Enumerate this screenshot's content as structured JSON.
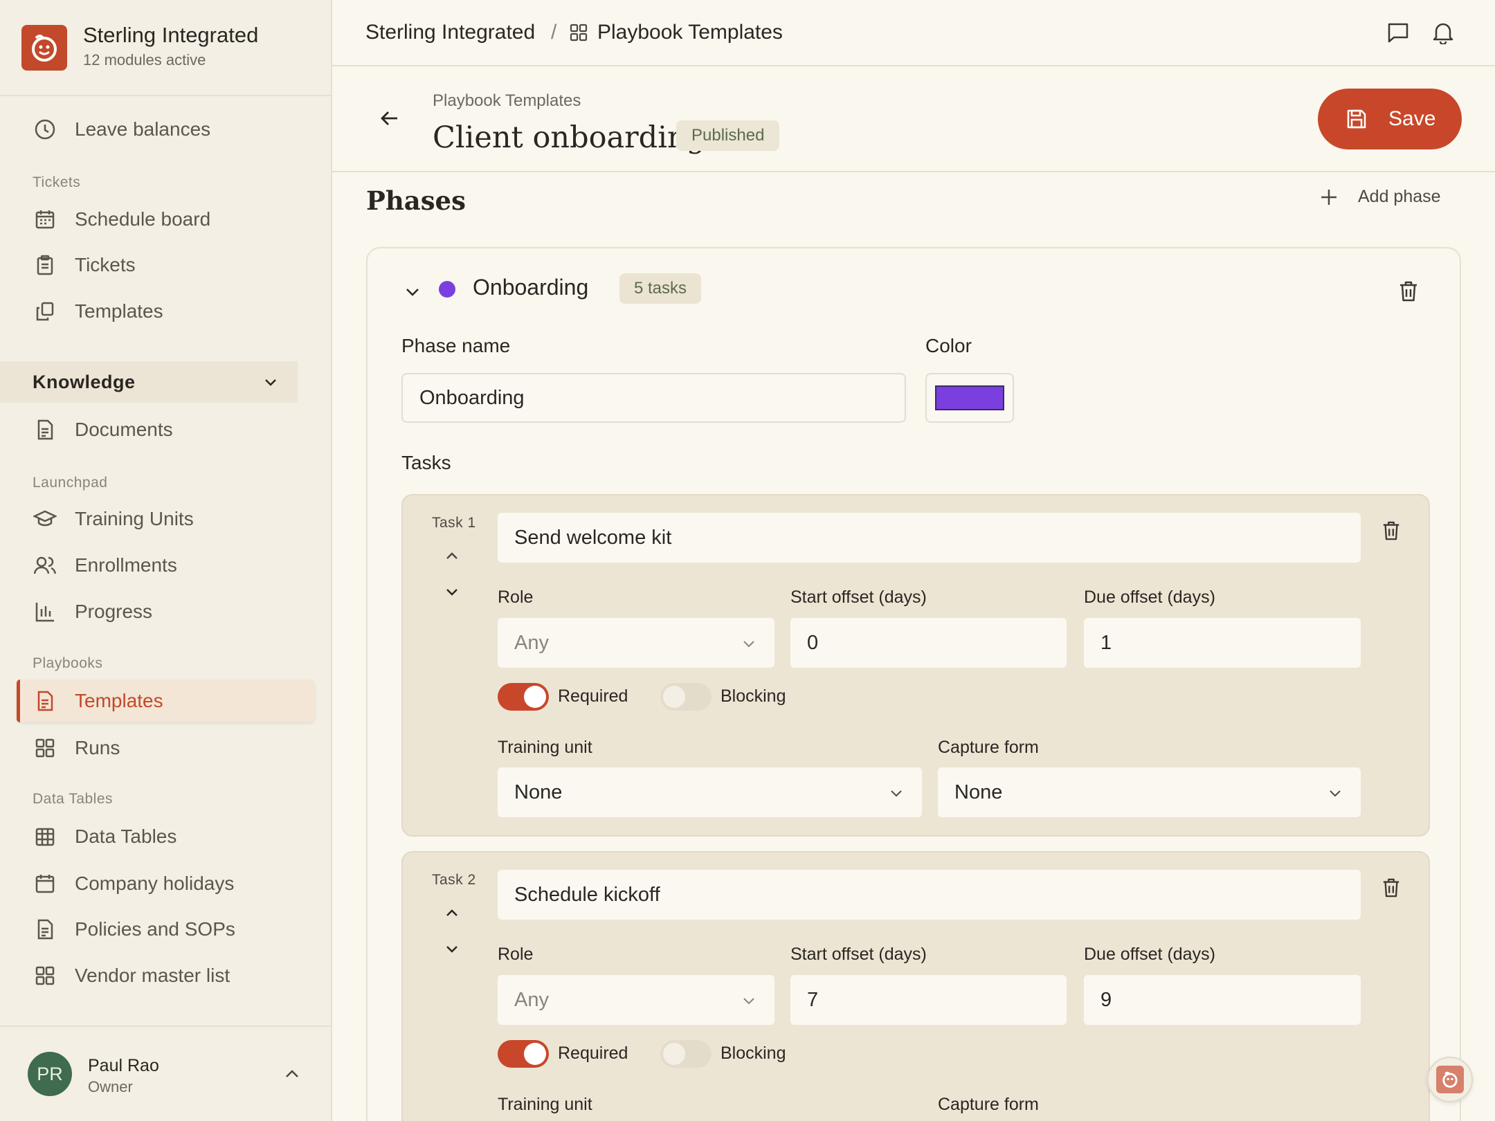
{
  "org": {
    "name": "Sterling Integrated",
    "subtitle": "12 modules active"
  },
  "sidebar": {
    "top_items": [
      {
        "label": "Leave balances",
        "icon": "clock-icon"
      }
    ],
    "sections": {
      "tickets": "Tickets",
      "launchpad": "Launchpad",
      "playbooks": "Playbooks",
      "data_tables": "Data Tables"
    },
    "tickets_items": [
      {
        "label": "Schedule board",
        "icon": "calendar-icon"
      },
      {
        "label": "Tickets",
        "icon": "clipboard-icon"
      },
      {
        "label": "Templates",
        "icon": "copy-icon"
      }
    ],
    "knowledge": {
      "label": "Knowledge",
      "items": [
        {
          "label": "Documents",
          "icon": "document-icon"
        }
      ]
    },
    "launchpad_items": [
      {
        "label": "Training Units",
        "icon": "graduation-cap-icon"
      },
      {
        "label": "Enrollments",
        "icon": "users-icon"
      },
      {
        "label": "Progress",
        "icon": "bar-chart-icon"
      }
    ],
    "playbooks_items": [
      {
        "label": "Templates",
        "icon": "document-icon",
        "active": true
      },
      {
        "label": "Runs",
        "icon": "grid-icon"
      }
    ],
    "data_tables_items": [
      {
        "label": "Data Tables",
        "icon": "table-icon"
      },
      {
        "label": "Company holidays",
        "icon": "calendar-icon"
      },
      {
        "label": "Policies and SOPs",
        "icon": "document-icon"
      },
      {
        "label": "Vendor master list",
        "icon": "grid-icon"
      }
    ],
    "user": {
      "initials": "PR",
      "name": "Paul Rao",
      "role": "Owner"
    }
  },
  "topbar": {
    "breadcrumb_root": "Sterling Integrated",
    "separator": "/",
    "breadcrumb_current": "Playbook Templates"
  },
  "header": {
    "breadcrumb": "Playbook Templates",
    "title": "Client onboarding",
    "status": "Published",
    "save_label": "Save"
  },
  "phases": {
    "title": "Phases",
    "add_label": "Add phase",
    "phase": {
      "name": "Onboarding",
      "task_count": "5 tasks",
      "color": "#7b3fe0",
      "phase_name_label": "Phase name",
      "phase_name_value": "Onboarding",
      "color_label": "Color",
      "tasks_label": "Tasks",
      "tasks": [
        {
          "num_label": "Task 1",
          "title": "Send welcome kit",
          "role_label": "Role",
          "role_value": "Any",
          "start_label": "Start offset (days)",
          "start_value": "0",
          "due_label": "Due offset (days)",
          "due_value": "1",
          "required_label": "Required",
          "required": true,
          "blocking_label": "Blocking",
          "blocking": false,
          "training_label": "Training unit",
          "training_value": "None",
          "capture_label": "Capture form",
          "capture_value": "None"
        },
        {
          "num_label": "Task 2",
          "title": "Schedule kickoff",
          "role_label": "Role",
          "role_value": "Any",
          "start_label": "Start offset (days)",
          "start_value": "7",
          "due_label": "Due offset (days)",
          "due_value": "9",
          "required_label": "Required",
          "required": true,
          "blocking_label": "Blocking",
          "blocking": false,
          "training_label": "Training unit",
          "capture_label": "Capture form"
        }
      ]
    }
  },
  "colors": {
    "accent": "#c8472a",
    "sidebar_bg": "#f3efe4",
    "task_bg": "#ede5d4"
  }
}
